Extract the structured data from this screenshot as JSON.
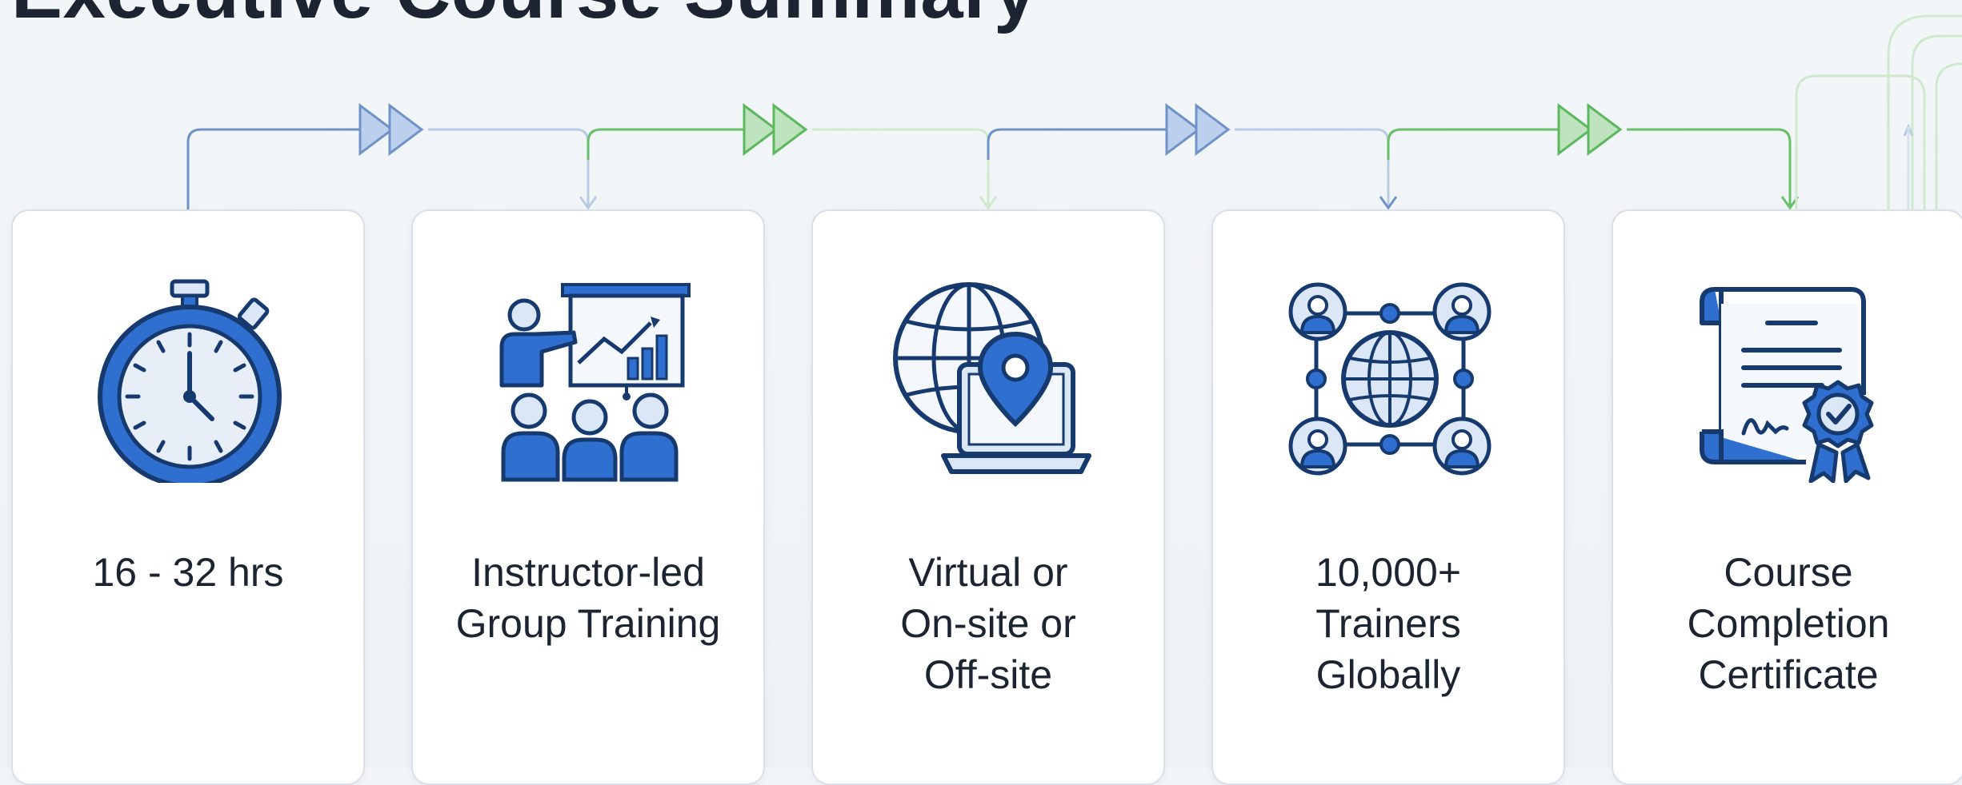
{
  "page": {
    "title": "Executive Course Summary"
  },
  "colors": {
    "blue": "#2f6fd0",
    "blue_dark": "#163a6e",
    "blue_light": "#dbe6f6",
    "green": "#5cb85c",
    "connector_blue": "#6f93c7",
    "connector_green": "#6abf6a"
  },
  "cards": [
    {
      "icon": "stopwatch-icon",
      "lines": [
        "16 - 32 hrs"
      ]
    },
    {
      "icon": "presenter-group-icon",
      "lines": [
        "Instructor-led",
        "Group Training"
      ]
    },
    {
      "icon": "globe-laptop-location-icon",
      "lines": [
        "Virtual or",
        "On-site or",
        "Off-site"
      ]
    },
    {
      "icon": "global-network-people-icon",
      "lines": [
        "10,000+",
        "Trainers",
        "Globally"
      ]
    },
    {
      "icon": "certificate-ribbon-icon",
      "lines": [
        "Course",
        "Completion",
        "Certificate"
      ]
    }
  ]
}
